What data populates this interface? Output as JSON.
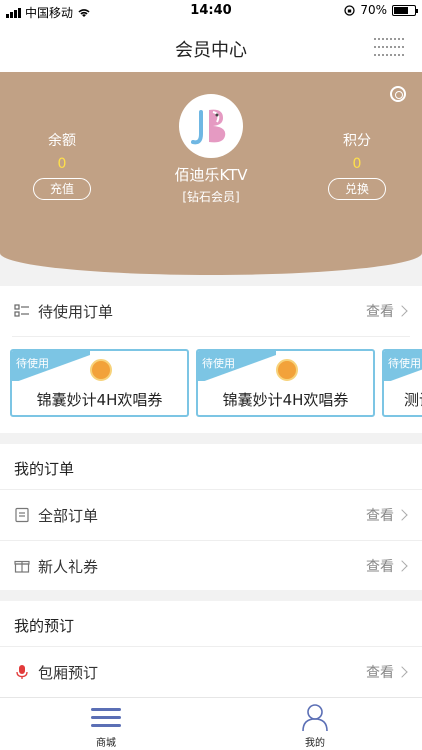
{
  "status": {
    "carrier": "中国移动",
    "time": "14:40",
    "battery": "70%"
  },
  "nav": {
    "title": "会员中心"
  },
  "profile": {
    "store_name": "佰迪乐KTV",
    "member_level": "[钻石会员]",
    "balance": {
      "label": "余额",
      "value": "0",
      "button": "充值"
    },
    "points": {
      "label": "积分",
      "value": "0",
      "button": "兑换"
    }
  },
  "pending": {
    "title": "待使用订单",
    "more": "查看",
    "coupons": [
      {
        "tag": "待使用",
        "name": "锦囊妙计4H欢唱券"
      },
      {
        "tag": "待使用",
        "name": "锦囊妙计4H欢唱券"
      },
      {
        "tag": "待使用",
        "name": "测试"
      }
    ]
  },
  "my_orders": {
    "title": "我的订单",
    "items": [
      {
        "label": "全部订单",
        "more": "查看"
      },
      {
        "label": "新人礼券",
        "more": "查看"
      }
    ]
  },
  "my_reservations": {
    "title": "我的预订",
    "items": [
      {
        "label": "包厢预订",
        "more": "查看"
      }
    ]
  },
  "tabbar": {
    "items": [
      {
        "label": "商城"
      },
      {
        "label": "我的"
      }
    ]
  },
  "colors": {
    "hero": "#c1a185",
    "accent": "#ffe04a",
    "coupon_border": "#7cc5e4",
    "tab_active": "#5b6fb5"
  }
}
